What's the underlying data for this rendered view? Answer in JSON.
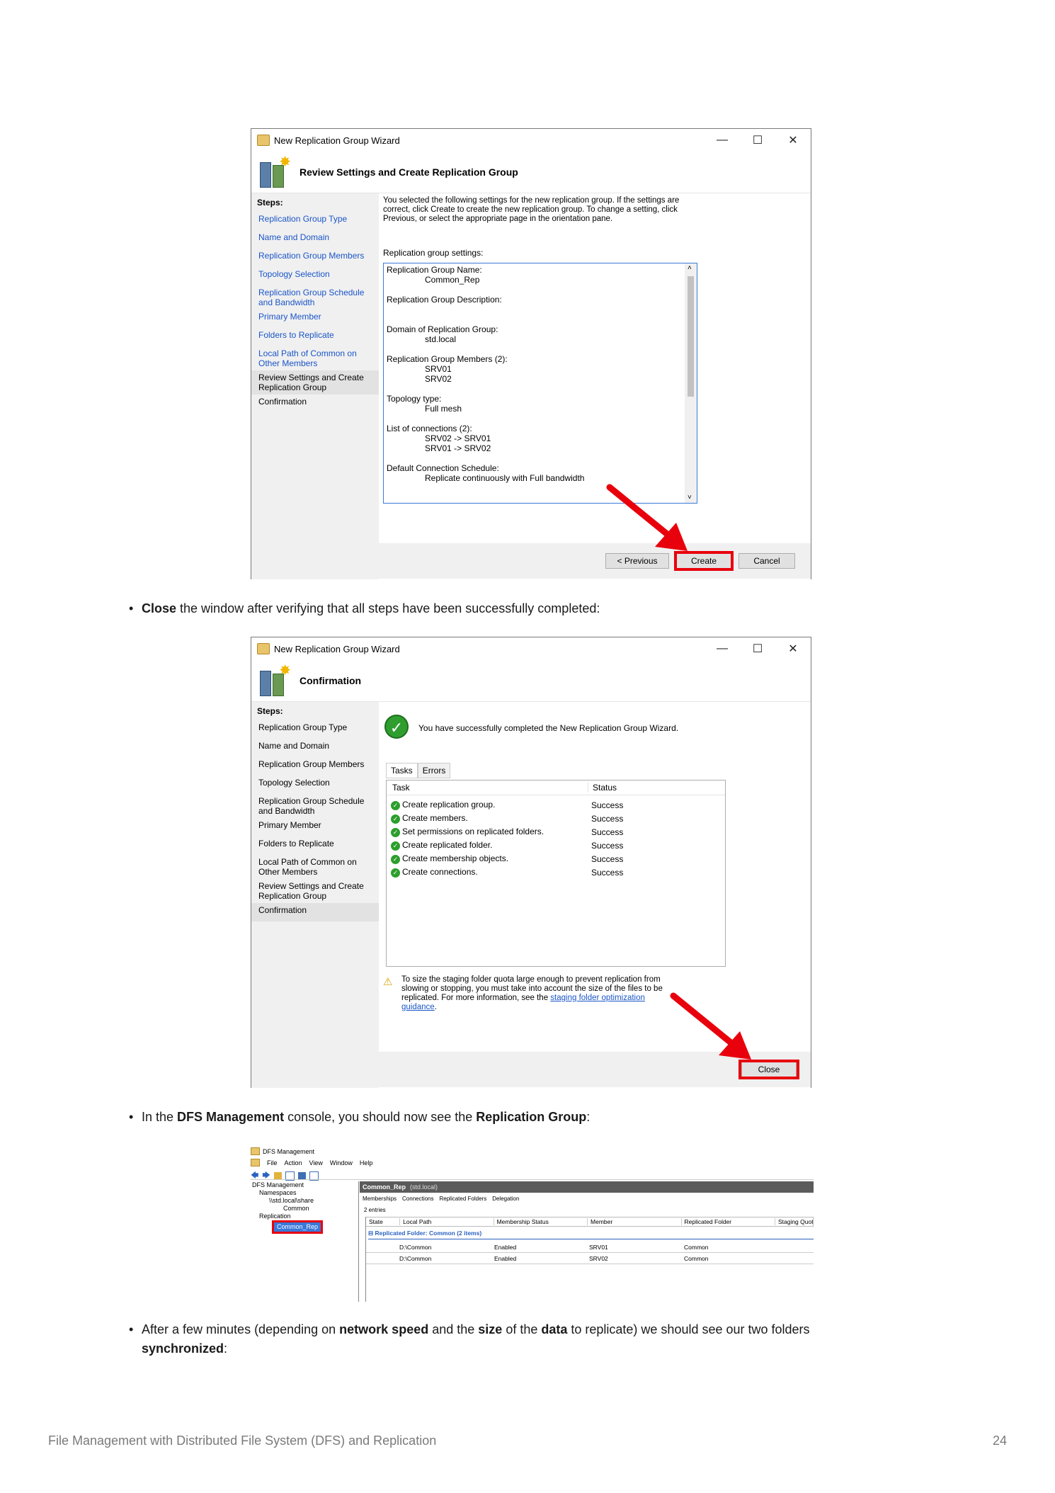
{
  "wizard1": {
    "title": "New Replication Group Wizard",
    "header": "Review Settings and Create Replication Group",
    "steps_title": "Steps:",
    "steps": [
      "Replication Group Type",
      "Name and Domain",
      "Replication Group Members",
      "Topology Selection",
      "Replication Group Schedule and Bandwidth",
      "Primary Member",
      "Folders to Replicate",
      "Local Path of Common on Other Members",
      "Review Settings and Create Replication Group",
      "Confirmation"
    ],
    "intro": "You selected the following settings for the new replication group. If the settings are correct, click Create to create the new replication group. To change a setting, click Previous, or select the appropriate page in the orientation pane.",
    "settings_label": "Replication group settings:",
    "settings": {
      "name_label": "Replication Group Name:",
      "name_value": "Common_Rep",
      "desc_label": "Replication Group Description:",
      "domain_label": "Domain of Replication Group:",
      "domain_value": "std.local",
      "members_label": "Replication Group Members (2):",
      "member1": "SRV01",
      "member2": "SRV02",
      "topology_label": "Topology type:",
      "topology_value": "Full mesh",
      "connections_label": "List of connections (2):",
      "conn1": "SRV02 -> SRV01",
      "conn2": "SRV01 -> SRV02",
      "schedule_label": "Default Connection Schedule:",
      "schedule_value": "Replicate continuously with Full bandwidth"
    },
    "buttons": {
      "previous": "< Previous",
      "create": "Create",
      "cancel": "Cancel"
    }
  },
  "para1": {
    "bold": "Close",
    "text": " the window after verifying that all steps have been successfully completed:"
  },
  "wizard2": {
    "title": "New Replication Group Wizard",
    "header": "Confirmation",
    "success_msg": "You have successfully completed the New Replication Group Wizard.",
    "tabs": [
      "Tasks",
      "Errors"
    ],
    "columns": [
      "Task",
      "Status"
    ],
    "tasks": [
      {
        "task": "Create replication group.",
        "status": "Success"
      },
      {
        "task": "Create members.",
        "status": "Success"
      },
      {
        "task": "Set permissions on replicated folders.",
        "status": "Success"
      },
      {
        "task": "Create replicated folder.",
        "status": "Success"
      },
      {
        "task": "Create membership objects.",
        "status": "Success"
      },
      {
        "task": "Create connections.",
        "status": "Success"
      }
    ],
    "warning": "To size the staging folder quota large enough to prevent replication from slowing or stopping, you must take into account the size of the files to be replicated. For more information, see the ",
    "warning_link": "staging folder optimization guidance",
    "warning_end": ".",
    "close": "Close"
  },
  "para2": {
    "pre": "In the ",
    "bold1": "DFS Management",
    "mid": " console, you should now see the ",
    "bold2": "Replication Group",
    "end": ":"
  },
  "dfs": {
    "title": "DFS Management",
    "menu": [
      "File",
      "Action",
      "View",
      "Window",
      "Help"
    ],
    "tree": [
      "DFS Management",
      "Namespaces",
      "\\\\std.local\\share",
      "Common",
      "Replication",
      "Common_Rep"
    ],
    "panel_title": "Common_Rep",
    "panel_domain": "(std.local)",
    "tabs": [
      "Memberships",
      "Connections",
      "Replicated Folders",
      "Delegation"
    ],
    "entries": "2 entries",
    "columns": [
      "State",
      "Local Path",
      "Membership Status",
      "Member",
      "Replicated Folder",
      "Staging Quota"
    ],
    "group": "Replicated Folder: Common (2 items)",
    "rows": [
      {
        "path": "D:\\Common",
        "status": "Enabled",
        "member": "SRV01",
        "folder": "Common"
      },
      {
        "path": "D:\\Common",
        "status": "Enabled",
        "member": "SRV02",
        "folder": "Common"
      }
    ]
  },
  "para3": {
    "pre": "After a few minutes (depending on ",
    "b1": "network speed",
    "m1": " and the ",
    "b2": "size",
    "m2": " of the ",
    "b3": "data",
    "m3": " to replicate) we should see our two folders ",
    "b4": "synchronized",
    "end": ":"
  },
  "footer": {
    "title": "File Management with Distributed File System (DFS) and Replication",
    "page": "24"
  }
}
